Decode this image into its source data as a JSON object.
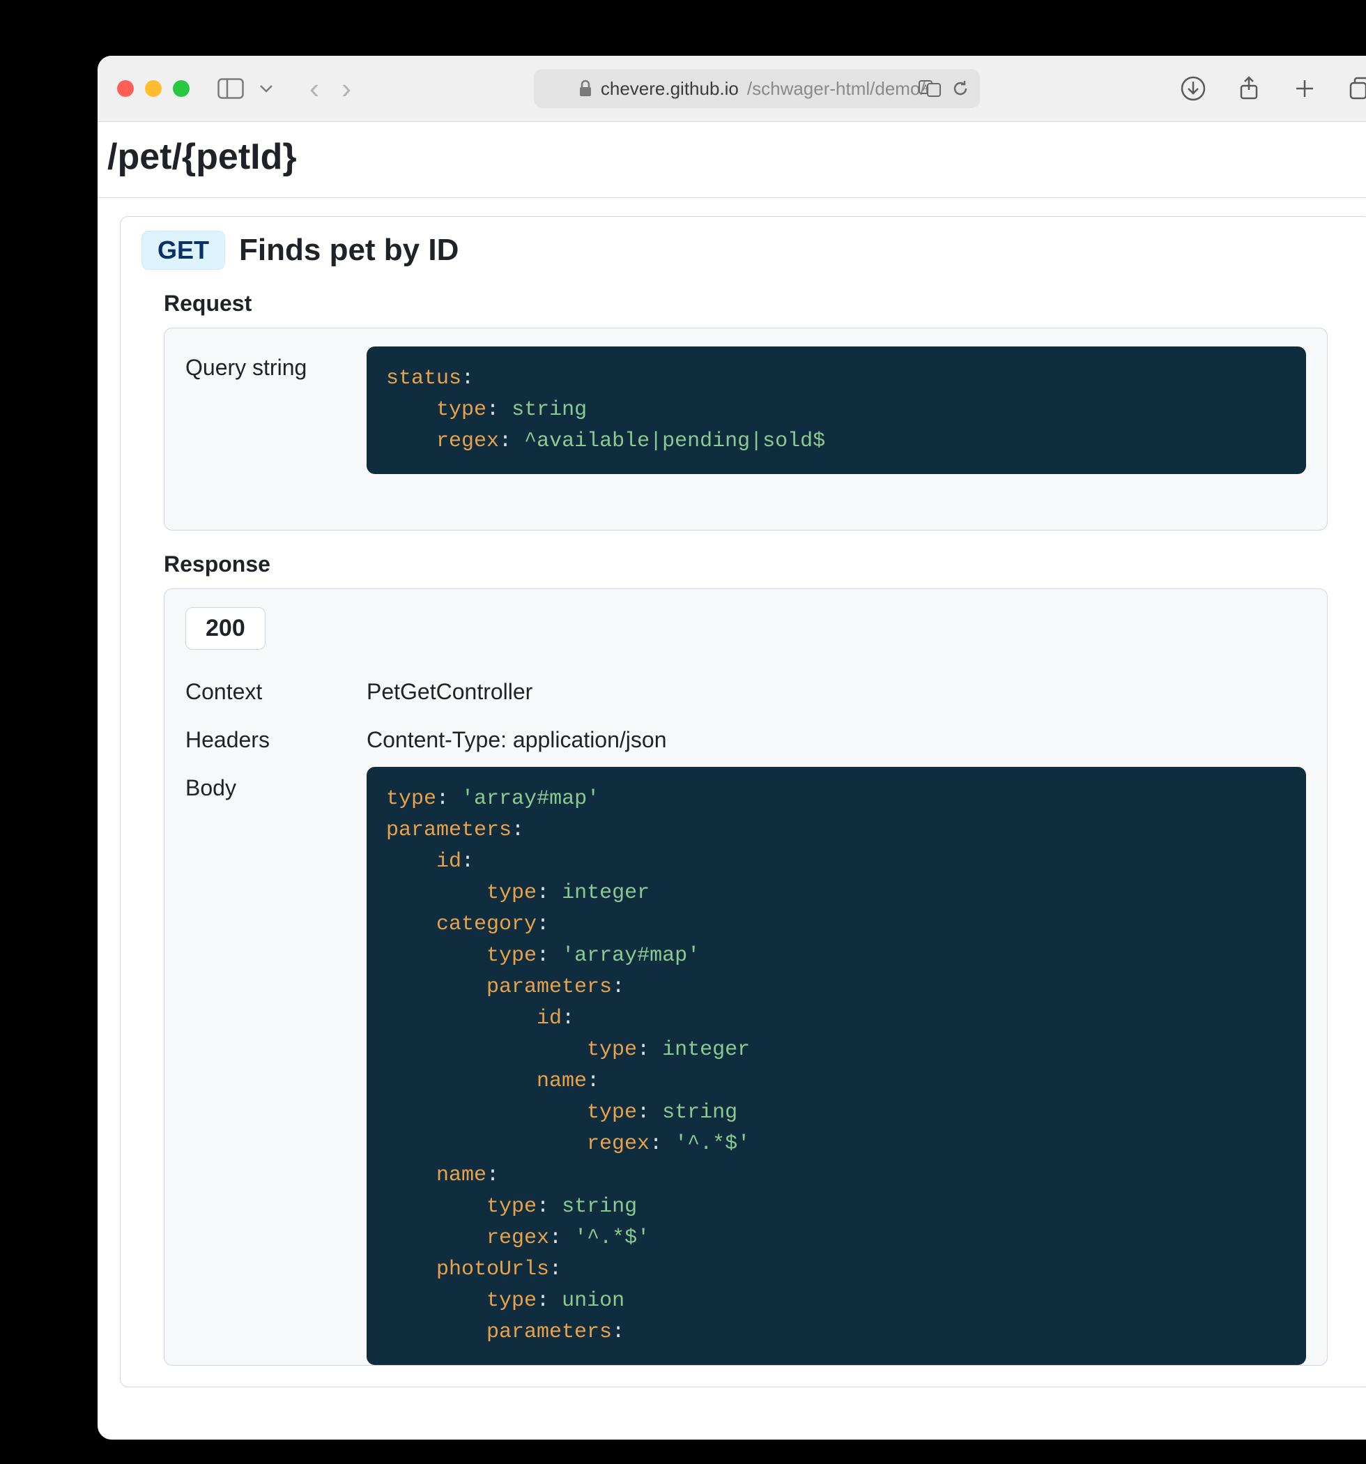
{
  "browser": {
    "url_host": "chevere.github.io",
    "url_path": "/schwager-html/demo/o"
  },
  "endpoint": {
    "path": "/pet/{petId}",
    "method": "GET",
    "summary": "Finds pet by ID"
  },
  "request": {
    "label": "Request",
    "query_label": "Query string",
    "query_code_html": "<span class=\"key\">status</span><span class=\"punct\">:</span>\n    <span class=\"key\">type</span><span class=\"punct\">:</span> <span class=\"val\">string</span>\n    <span class=\"key\">regex</span><span class=\"punct\">:</span> <span class=\"val\">^available|pending|sold$</span>"
  },
  "response": {
    "label": "Response",
    "status_code": "200",
    "context_label": "Context",
    "context_value": "PetGetController",
    "headers_label": "Headers",
    "headers_value": "Content-Type: application/json",
    "body_label": "Body",
    "body_code_html": "<span class=\"key\">type</span><span class=\"punct\">:</span> <span class=\"val\">'array#map'</span>\n<span class=\"key\">parameters</span><span class=\"punct\">:</span>\n    <span class=\"key\">id</span><span class=\"punct\">:</span>\n        <span class=\"key\">type</span><span class=\"punct\">:</span> <span class=\"val\">integer</span>\n    <span class=\"key\">category</span><span class=\"punct\">:</span>\n        <span class=\"key\">type</span><span class=\"punct\">:</span> <span class=\"val\">'array#map'</span>\n        <span class=\"key\">parameters</span><span class=\"punct\">:</span>\n            <span class=\"key\">id</span><span class=\"punct\">:</span>\n                <span class=\"key\">type</span><span class=\"punct\">:</span> <span class=\"val\">integer</span>\n            <span class=\"key\">name</span><span class=\"punct\">:</span>\n                <span class=\"key\">type</span><span class=\"punct\">:</span> <span class=\"val\">string</span>\n                <span class=\"key\">regex</span><span class=\"punct\">:</span> <span class=\"val\">'^.*$'</span>\n    <span class=\"key\">name</span><span class=\"punct\">:</span>\n        <span class=\"key\">type</span><span class=\"punct\">:</span> <span class=\"val\">string</span>\n        <span class=\"key\">regex</span><span class=\"punct\">:</span> <span class=\"val\">'^.*$'</span>\n    <span class=\"key\">photoUrls</span><span class=\"punct\">:</span>\n        <span class=\"key\">type</span><span class=\"punct\">:</span> <span class=\"val\">union</span>\n        <span class=\"key\">parameters</span><span class=\"punct\">:</span>"
  }
}
